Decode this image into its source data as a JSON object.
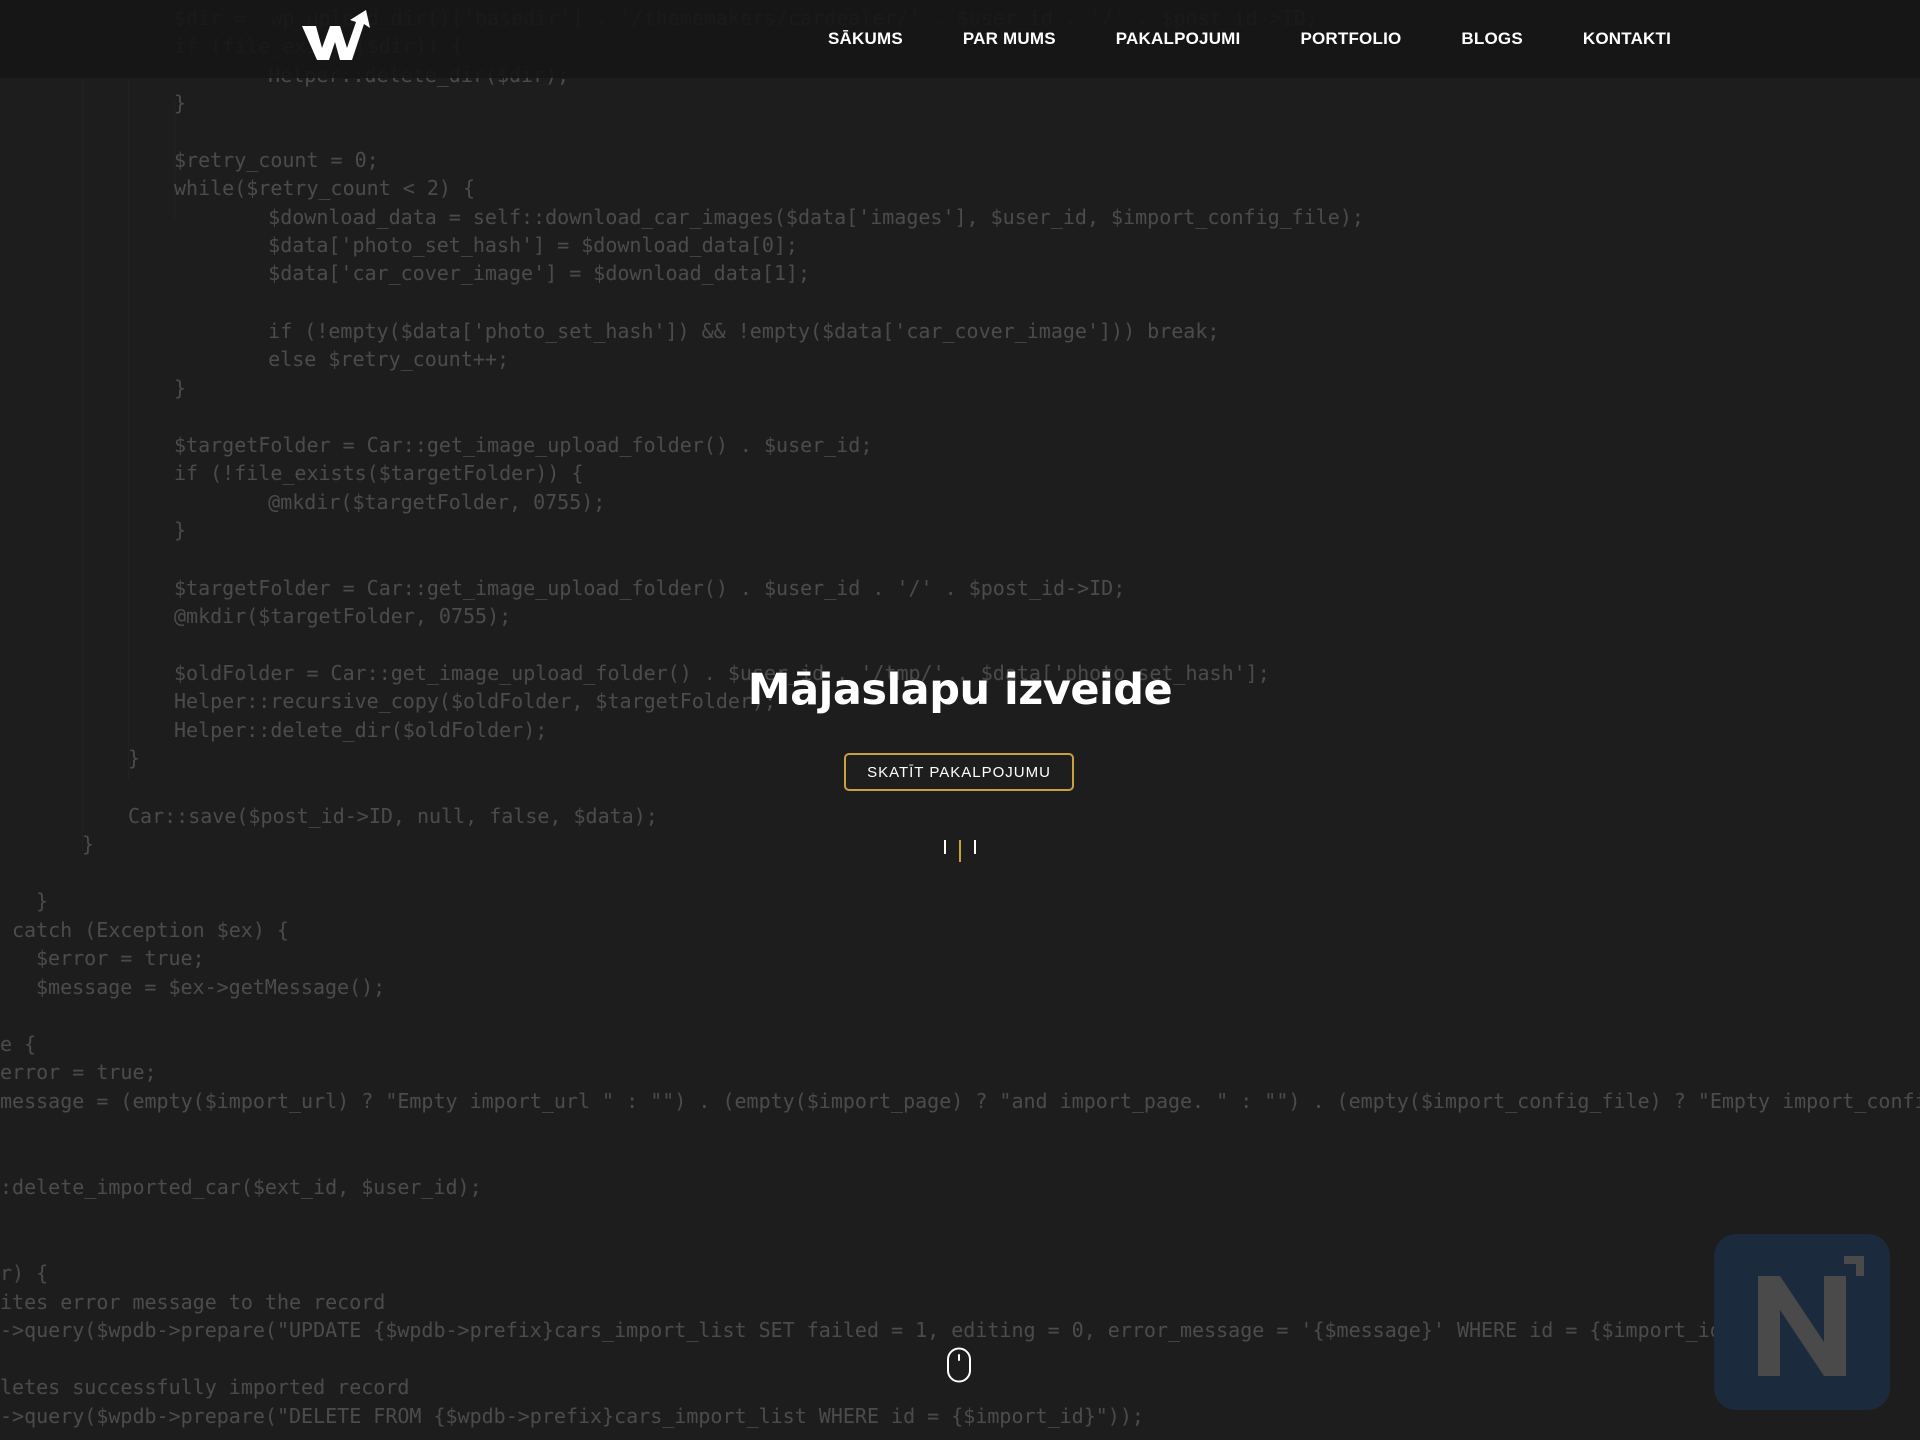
{
  "code_lines": [
    "$dir =  wp_upload_dir()['basedir'] . '/thememakers/cardealer/' . $user_id . '/' . $post_id->ID;",
    "if (file_exists($dir)) {",
    "    Helper::delete_dir($dir);",
    "}",
    "",
    "$retry_count = 0;",
    "while($retry_count < 2) {",
    "    $download_data = self::download_car_images($data['images'], $user_id, $import_config_file);",
    "    $data['photo_set_hash'] = $download_data[0];",
    "    $data['car_cover_image'] = $download_data[1];",
    "",
    "    if (!empty($data['photo_set_hash']) && !empty($data['car_cover_image'])) break;",
    "    else $retry_count++;",
    "}",
    "",
    "$targetFolder = Car::get_image_upload_folder() . $user_id;",
    "if (!file_exists($targetFolder)) {",
    "    @mkdir($targetFolder, 0755);",
    "}",
    "",
    "$targetFolder = Car::get_image_upload_folder() . $user_id . '/' . $post_id->ID;",
    "@mkdir($targetFolder, 0755);",
    "",
    "$oldFolder = Car::get_image_upload_folder() . $user_id . '/tmp/' . $data['photo_set_hash'];",
    "Helper::recursive_copy($oldFolder, $targetFolder);",
    "Helper::delete_dir($oldFolder);",
    "}",
    "",
    "Car::save($post_id->ID, null, false, $data);",
    "}",
    "",
    "}",
    "catch (Exception $ex) {",
    "$error = true;",
    "$message = $ex->getMessage();",
    "",
    "e {",
    "error = true;",
    "message = (empty($import_url) ? \"Empty import_url \" : \"\") . (empty($import_page) ? \"and import_page. \" : \"\") . (empty($import_config_file) ? \"Empty import_config_file",
    "",
    "",
    ":delete_imported_car($ext_id, $user_id);",
    "",
    "",
    "",
    "r) {",
    "ites error message to the record",
    "->query($wpdb->prepare(\"UPDATE {$wpdb->prefix}cars_import_list SET failed = 1, editing = 0, error_message = '{$message}' WHERE id = {$import_id}\"));",
    "",
    "letes successfully imported record",
    "->query($wpdb->prepare(\"DELETE FROM {$wpdb->prefix}cars_import_list WHERE id = {$import_id}\"));"
  ],
  "nav": {
    "items": [
      "SĀKUMS",
      "PAR MUMS",
      "PAKALPOJUMI",
      "PORTFOLIO",
      "BLOGS",
      "KONTAKTI"
    ]
  },
  "hero": {
    "title": "Mājaslapu izveide",
    "cta_label": "SKATĪT PAKALPOJUMU"
  },
  "icons": {
    "logo": "w-logo-icon",
    "loader": "loading-bars-icon",
    "scroll": "mouse-scroll-icon",
    "badge": "n-badge-icon"
  },
  "colors": {
    "background": "#232323",
    "navbar": "#161616",
    "accent": "#c9a03d",
    "badge_bg": "#1c2a3e",
    "badge_letter": "#4a4a4a"
  }
}
